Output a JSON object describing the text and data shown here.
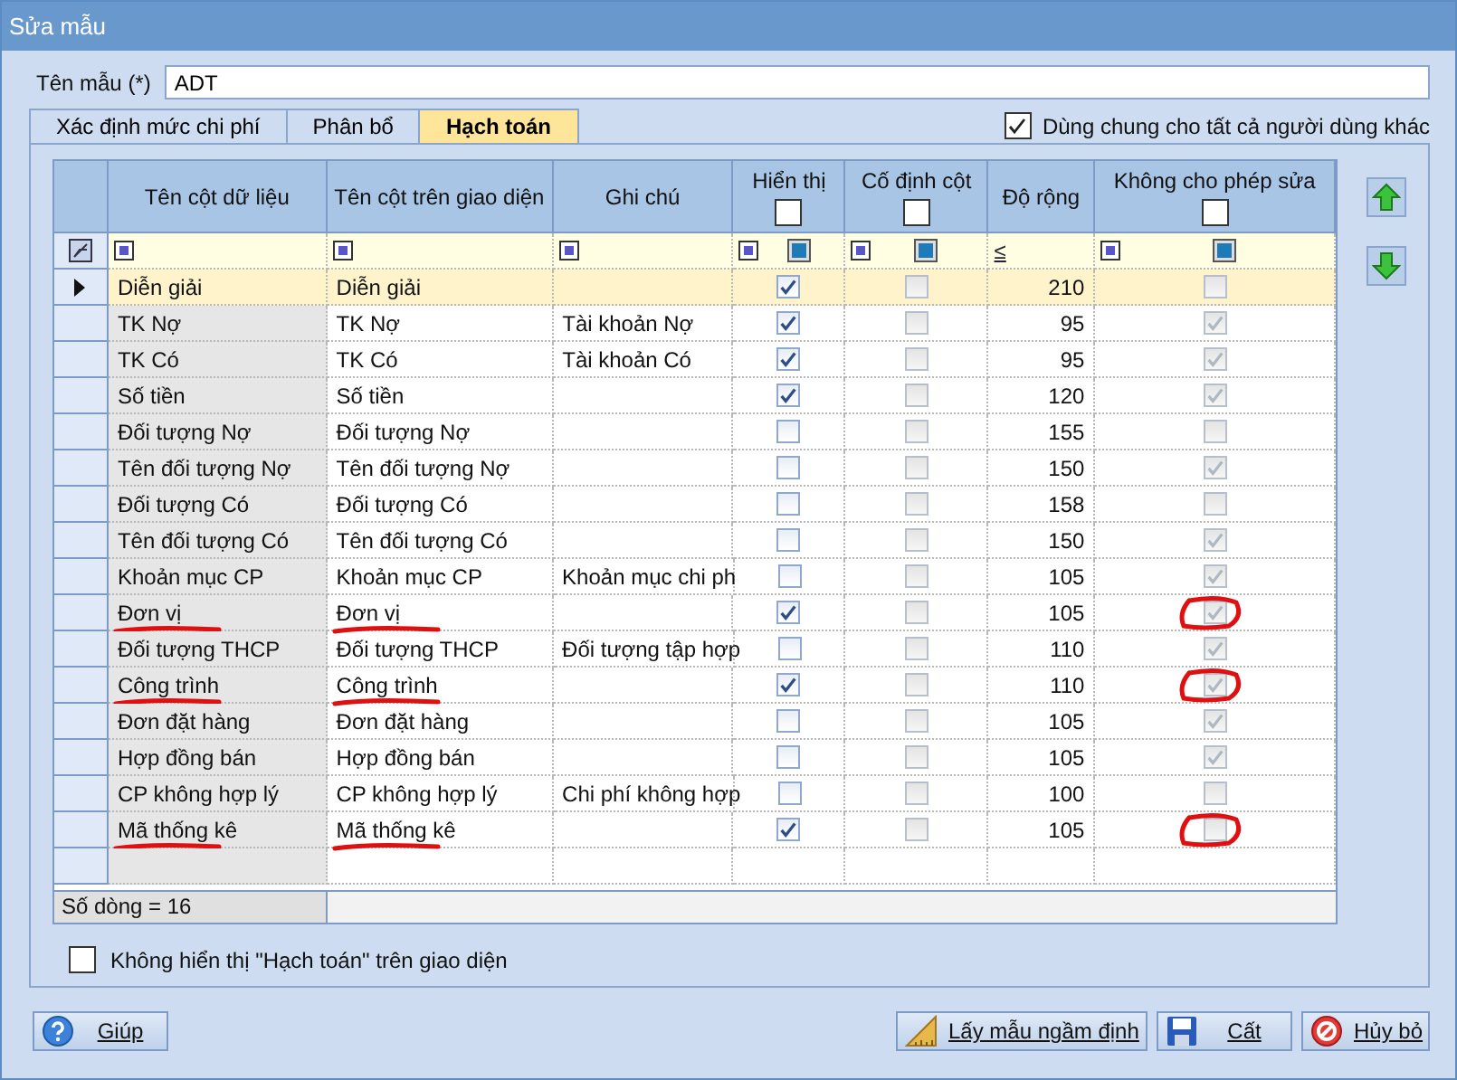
{
  "window": {
    "title": "Sửa mẫu"
  },
  "template_name": {
    "label": "Tên mẫu (*)",
    "value": "ADT"
  },
  "tabs": [
    {
      "label": "Xác định mức chi phí",
      "selected": false
    },
    {
      "label": "Phân bổ",
      "selected": false
    },
    {
      "label": "Hạch toán",
      "selected": true
    }
  ],
  "share_option": {
    "label": "Dùng chung cho tất cả người dùng khác",
    "checked": true
  },
  "grid": {
    "columns": [
      {
        "label": "Tên cột dữ liệu",
        "kind": "text"
      },
      {
        "label": "Tên cột trên giao diện",
        "kind": "text"
      },
      {
        "label": "Ghi chú",
        "kind": "text"
      },
      {
        "label": "Hiển thị",
        "kind": "check",
        "checked": false,
        "disabled": false
      },
      {
        "label": "Cố định cột",
        "kind": "check",
        "checked": false,
        "disabled": true
      },
      {
        "label": "Độ rộng",
        "kind": "number",
        "filter_operator": "≤"
      },
      {
        "label": "Không cho phép sửa",
        "kind": "check",
        "checked": false,
        "disabled": true
      }
    ],
    "rows": [
      {
        "selected": true,
        "marked": false,
        "cells": [
          "Diễn giải",
          "Diễn giải",
          "",
          true,
          false,
          "210",
          false
        ]
      },
      {
        "selected": false,
        "marked": false,
        "cells": [
          "TK Nợ",
          "TK Nợ",
          "Tài khoản Nợ",
          true,
          false,
          "95",
          true
        ]
      },
      {
        "selected": false,
        "marked": false,
        "cells": [
          "TK Có",
          "TK Có",
          "Tài khoản Có",
          true,
          false,
          "95",
          true
        ]
      },
      {
        "selected": false,
        "marked": false,
        "cells": [
          "Số tiền",
          "Số tiền",
          "",
          true,
          false,
          "120",
          true
        ]
      },
      {
        "selected": false,
        "marked": false,
        "cells": [
          "Đối tượng Nợ",
          "Đối tượng Nợ",
          "",
          false,
          false,
          "155",
          false
        ]
      },
      {
        "selected": false,
        "marked": false,
        "cells": [
          "Tên đối tượng Nợ",
          "Tên đối tượng Nợ",
          "",
          false,
          false,
          "150",
          true
        ]
      },
      {
        "selected": false,
        "marked": false,
        "cells": [
          "Đối tượng Có",
          "Đối tượng Có",
          "",
          false,
          false,
          "158",
          false
        ]
      },
      {
        "selected": false,
        "marked": false,
        "cells": [
          "Tên đối tượng Có",
          "Tên đối tượng Có",
          "",
          false,
          false,
          "150",
          true
        ]
      },
      {
        "selected": false,
        "marked": false,
        "cells": [
          "Khoản mục CP",
          "Khoản mục CP",
          "Khoản mục chi ph",
          false,
          false,
          "105",
          true
        ]
      },
      {
        "selected": false,
        "marked": true,
        "cells": [
          "Đơn vị",
          "Đơn vị",
          "",
          true,
          false,
          "105",
          true
        ]
      },
      {
        "selected": false,
        "marked": false,
        "cells": [
          "Đối tượng THCP",
          "Đối tượng THCP",
          "Đối tượng tập hợp",
          false,
          false,
          "110",
          true
        ]
      },
      {
        "selected": false,
        "marked": true,
        "cells": [
          "Công trình",
          "Công trình",
          "",
          true,
          false,
          "110",
          true
        ]
      },
      {
        "selected": false,
        "marked": false,
        "cells": [
          "Đơn đặt hàng",
          "Đơn đặt hàng",
          "",
          false,
          false,
          "105",
          true
        ]
      },
      {
        "selected": false,
        "marked": false,
        "cells": [
          "Hợp đồng bán",
          "Hợp đồng bán",
          "",
          false,
          false,
          "105",
          true
        ]
      },
      {
        "selected": false,
        "marked": false,
        "cells": [
          "CP không hợp lý",
          "CP không hợp lý",
          "Chi phí không hợp",
          false,
          false,
          "100",
          false
        ]
      },
      {
        "selected": false,
        "marked": true,
        "cells": [
          "Mã thống kê",
          "Mã thống kê",
          "",
          true,
          false,
          "105",
          false
        ]
      }
    ],
    "footer": "Số dòng = 16"
  },
  "hide_option": {
    "label": "Không hiển thị \"Hạch toán\" trên giao diện",
    "checked": false
  },
  "buttons": [
    {
      "label": "Giúp",
      "kind": "help"
    },
    {
      "label": "Lấy mẫu ngầm định",
      "kind": "default"
    },
    {
      "label": "Cất",
      "kind": "save"
    },
    {
      "label": "Hủy bỏ",
      "kind": "cancel"
    }
  ]
}
